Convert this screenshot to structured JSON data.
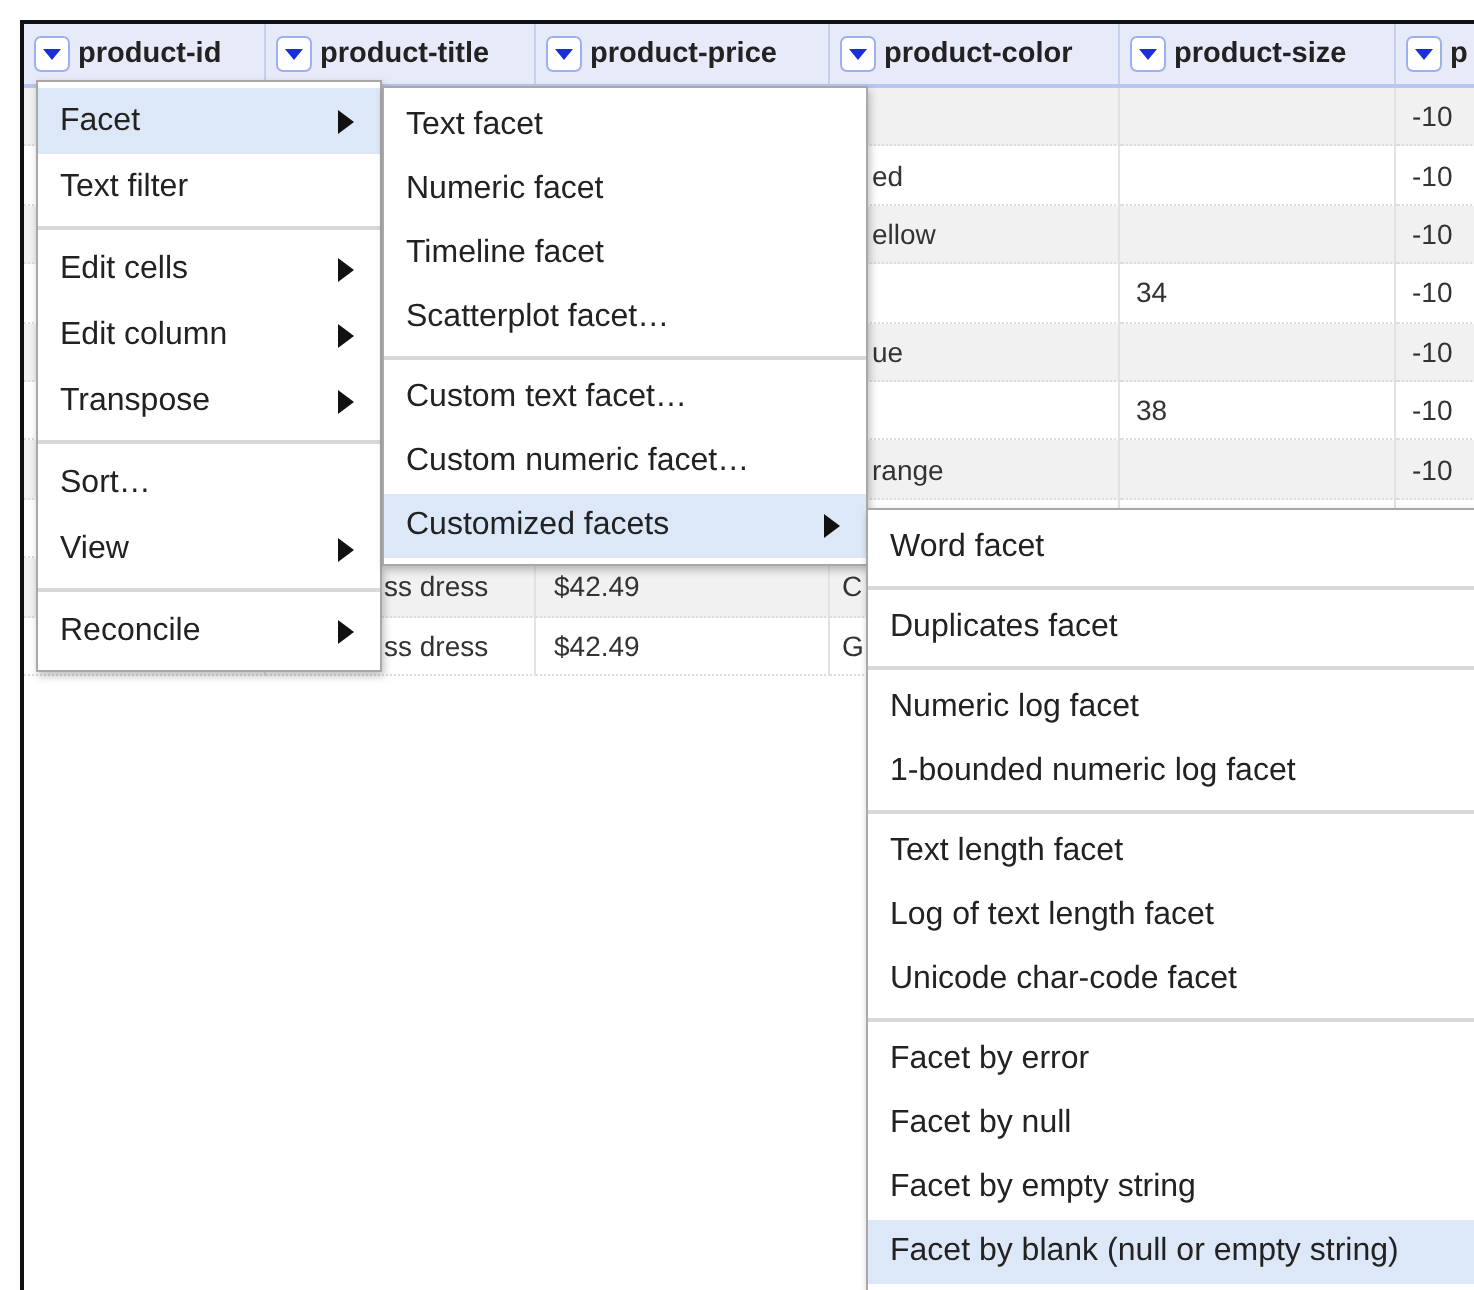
{
  "table": {
    "columns": [
      "product-id",
      "product-title",
      "product-price",
      "product-color",
      "product-size",
      "p"
    ],
    "rows": [
      {
        "cells": {
          "column_6": "-10"
        }
      },
      {
        "cells": {
          "product-color": "ed",
          "column_6": "-10"
        }
      },
      {
        "cells": {
          "product-color": "ellow",
          "column_6": "-10"
        }
      },
      {
        "cells": {
          "product-size": "34",
          "column_6": "-10"
        }
      },
      {
        "cells": {
          "product-color": "ue",
          "column_6": "-10"
        }
      },
      {
        "cells": {
          "product-size": "38",
          "column_6": "-10"
        }
      },
      {
        "cells": {
          "product-color": "range",
          "column_6": "-10"
        }
      },
      {
        "cells": {}
      },
      {
        "cells": {
          "product-title": "ss dress",
          "product-price": "$42.49",
          "product-color": "C"
        }
      },
      {
        "cells": {
          "product-title": "ss dress",
          "product-price": "$42.49",
          "product-color": "G"
        }
      }
    ]
  },
  "menus": [
    {
      "items": [
        {
          "kind": "item",
          "label": "Facet",
          "submenu": true,
          "selected": true
        },
        {
          "kind": "item",
          "label": "Text filter",
          "submenu": false,
          "selected": false
        },
        {
          "kind": "separator"
        },
        {
          "kind": "item",
          "label": "Edit cells",
          "submenu": true,
          "selected": false
        },
        {
          "kind": "item",
          "label": "Edit column",
          "submenu": true,
          "selected": false
        },
        {
          "kind": "item",
          "label": "Transpose",
          "submenu": true,
          "selected": false
        },
        {
          "kind": "separator"
        },
        {
          "kind": "item",
          "label": "Sort…",
          "submenu": false,
          "selected": false
        },
        {
          "kind": "item",
          "label": "View",
          "submenu": true,
          "selected": false
        },
        {
          "kind": "separator"
        },
        {
          "kind": "item",
          "label": "Reconcile",
          "submenu": true,
          "selected": false
        }
      ]
    },
    {
      "items": [
        {
          "kind": "item",
          "label": "Text facet",
          "submenu": false,
          "selected": false
        },
        {
          "kind": "item",
          "label": "Numeric facet",
          "submenu": false,
          "selected": false
        },
        {
          "kind": "item",
          "label": "Timeline facet",
          "submenu": false,
          "selected": false
        },
        {
          "kind": "item",
          "label": "Scatterplot facet…",
          "submenu": false,
          "selected": false
        },
        {
          "kind": "separator"
        },
        {
          "kind": "item",
          "label": "Custom text facet…",
          "submenu": false,
          "selected": false
        },
        {
          "kind": "item",
          "label": "Custom numeric facet…",
          "submenu": false,
          "selected": false
        },
        {
          "kind": "item",
          "label": "Customized facets",
          "submenu": true,
          "selected": true
        }
      ]
    },
    {
      "items": [
        {
          "kind": "item",
          "label": "Word facet",
          "submenu": false,
          "selected": false
        },
        {
          "kind": "separator"
        },
        {
          "kind": "item",
          "label": "Duplicates facet",
          "submenu": false,
          "selected": false
        },
        {
          "kind": "separator"
        },
        {
          "kind": "item",
          "label": "Numeric log facet",
          "submenu": false,
          "selected": false
        },
        {
          "kind": "item",
          "label": "1-bounded numeric log facet",
          "submenu": false,
          "selected": false
        },
        {
          "kind": "separator"
        },
        {
          "kind": "item",
          "label": "Text length facet",
          "submenu": false,
          "selected": false
        },
        {
          "kind": "item",
          "label": "Log of text length facet",
          "submenu": false,
          "selected": false
        },
        {
          "kind": "item",
          "label": "Unicode char-code facet",
          "submenu": false,
          "selected": false
        },
        {
          "kind": "separator"
        },
        {
          "kind": "item",
          "label": "Facet by error",
          "submenu": false,
          "selected": false
        },
        {
          "kind": "item",
          "label": "Facet by null",
          "submenu": false,
          "selected": false
        },
        {
          "kind": "item",
          "label": "Facet by empty string",
          "submenu": false,
          "selected": false
        },
        {
          "kind": "item",
          "label": "Facet by blank (null or empty string)",
          "submenu": false,
          "selected": true
        }
      ]
    }
  ]
}
